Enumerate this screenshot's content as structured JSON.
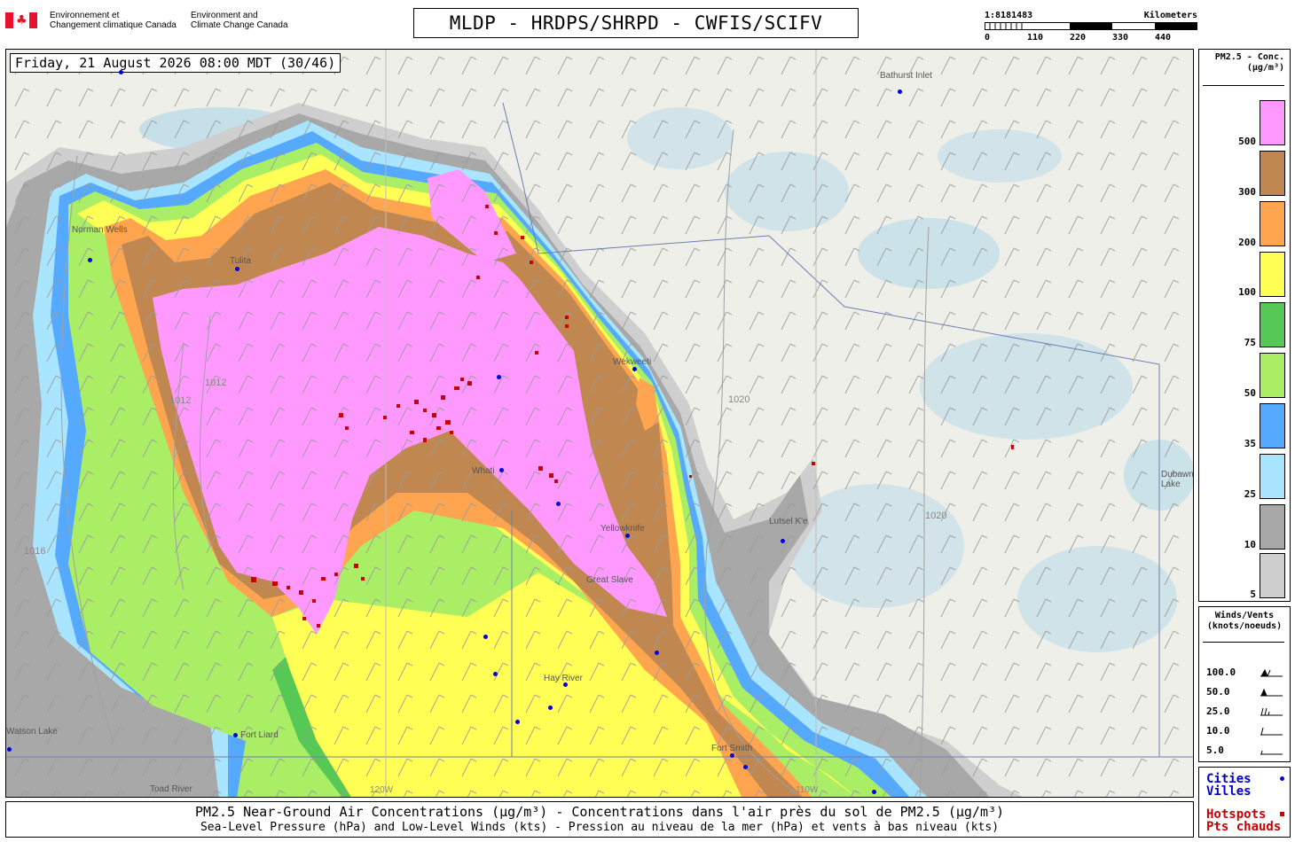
{
  "header": {
    "dept_fr": "Environnement et\nChangement climatique Canada",
    "dept_en": "Environment and\nClimate Change Canada",
    "title": "MLDP - HRDPS/SHRPD - CWFIS/SCIFV"
  },
  "scale": {
    "ratio": "1:8181483",
    "unit": "Kilometers",
    "ticks": [
      "0",
      "110",
      "220",
      "330",
      "440"
    ]
  },
  "map": {
    "datetime": "Friday, 21 August 2026 08:00 MDT (30/46)",
    "isobar_labels": [
      "1012",
      "1016",
      "1020"
    ],
    "meridian_labels": [
      "120W",
      "110W"
    ],
    "cities": [
      {
        "name": "Norman Wells",
        "tag": "norman-wells"
      },
      {
        "name": "Tulita",
        "tag": "tulita"
      },
      {
        "name": "Wekweeti",
        "tag": "wekweeti"
      },
      {
        "name": "Whati",
        "tag": "whati"
      },
      {
        "name": "Yellowknife",
        "tag": "yellowknife"
      },
      {
        "name": "Great Slave",
        "tag": "great-slave"
      },
      {
        "name": "Hay River",
        "tag": "hay-river"
      },
      {
        "name": "Fort Liard",
        "tag": "fort-liard"
      },
      {
        "name": "Fort Smith",
        "tag": "fort-smith"
      },
      {
        "name": "Lutsel K'e",
        "tag": "lutsel-ke"
      },
      {
        "name": "Bathurst Inlet",
        "tag": "bathurst-inlet"
      },
      {
        "name": "Dubawnt Lake",
        "tag": "dubawnt-lake"
      },
      {
        "name": "Watson Lake",
        "tag": "watson-lake"
      },
      {
        "name": "Toad River",
        "tag": "toad-river"
      }
    ]
  },
  "legend": {
    "title": "PM2.5 - Conc.\n(µg/m³)",
    "bins": [
      {
        "label": "500",
        "color": "#ff99ff"
      },
      {
        "label": "300",
        "color": "#c08850"
      },
      {
        "label": "200",
        "color": "#ffa54f"
      },
      {
        "label": "100",
        "color": "#ffff55"
      },
      {
        "label": "75",
        "color": "#55c855"
      },
      {
        "label": "50",
        "color": "#aaee66"
      },
      {
        "label": "35",
        "color": "#55aaff"
      },
      {
        "label": "25",
        "color": "#aae5ff"
      },
      {
        "label": "10",
        "color": "#a8a8a8"
      },
      {
        "label": "5",
        "color": "#cfcfcf"
      }
    ]
  },
  "winds": {
    "title": "Winds/Vents\n(knots/noeuds)",
    "rows": [
      "100.0",
      "50.0",
      "25.0",
      "10.0",
      "5.0"
    ]
  },
  "cities_legend": {
    "cities": "Cities\nVilles",
    "hotspots": "Hotspots\nPts chauds"
  },
  "footer": {
    "line1": "PM2.5 Near-Ground Air Concentrations (µg/m³) - Concentrations dans l'air près du sol de PM2.5 (µg/m³)",
    "line2": "Sea-Level Pressure (hPa) and Low-Level Winds (kts) - Pression au niveau de la mer (hPa) et vents à bas niveau (kts)"
  },
  "colors": {
    "city_dot": "#0000dd",
    "hotspot": "#cc0000",
    "lake": "#a8d5e8",
    "land": "#efefe9"
  }
}
